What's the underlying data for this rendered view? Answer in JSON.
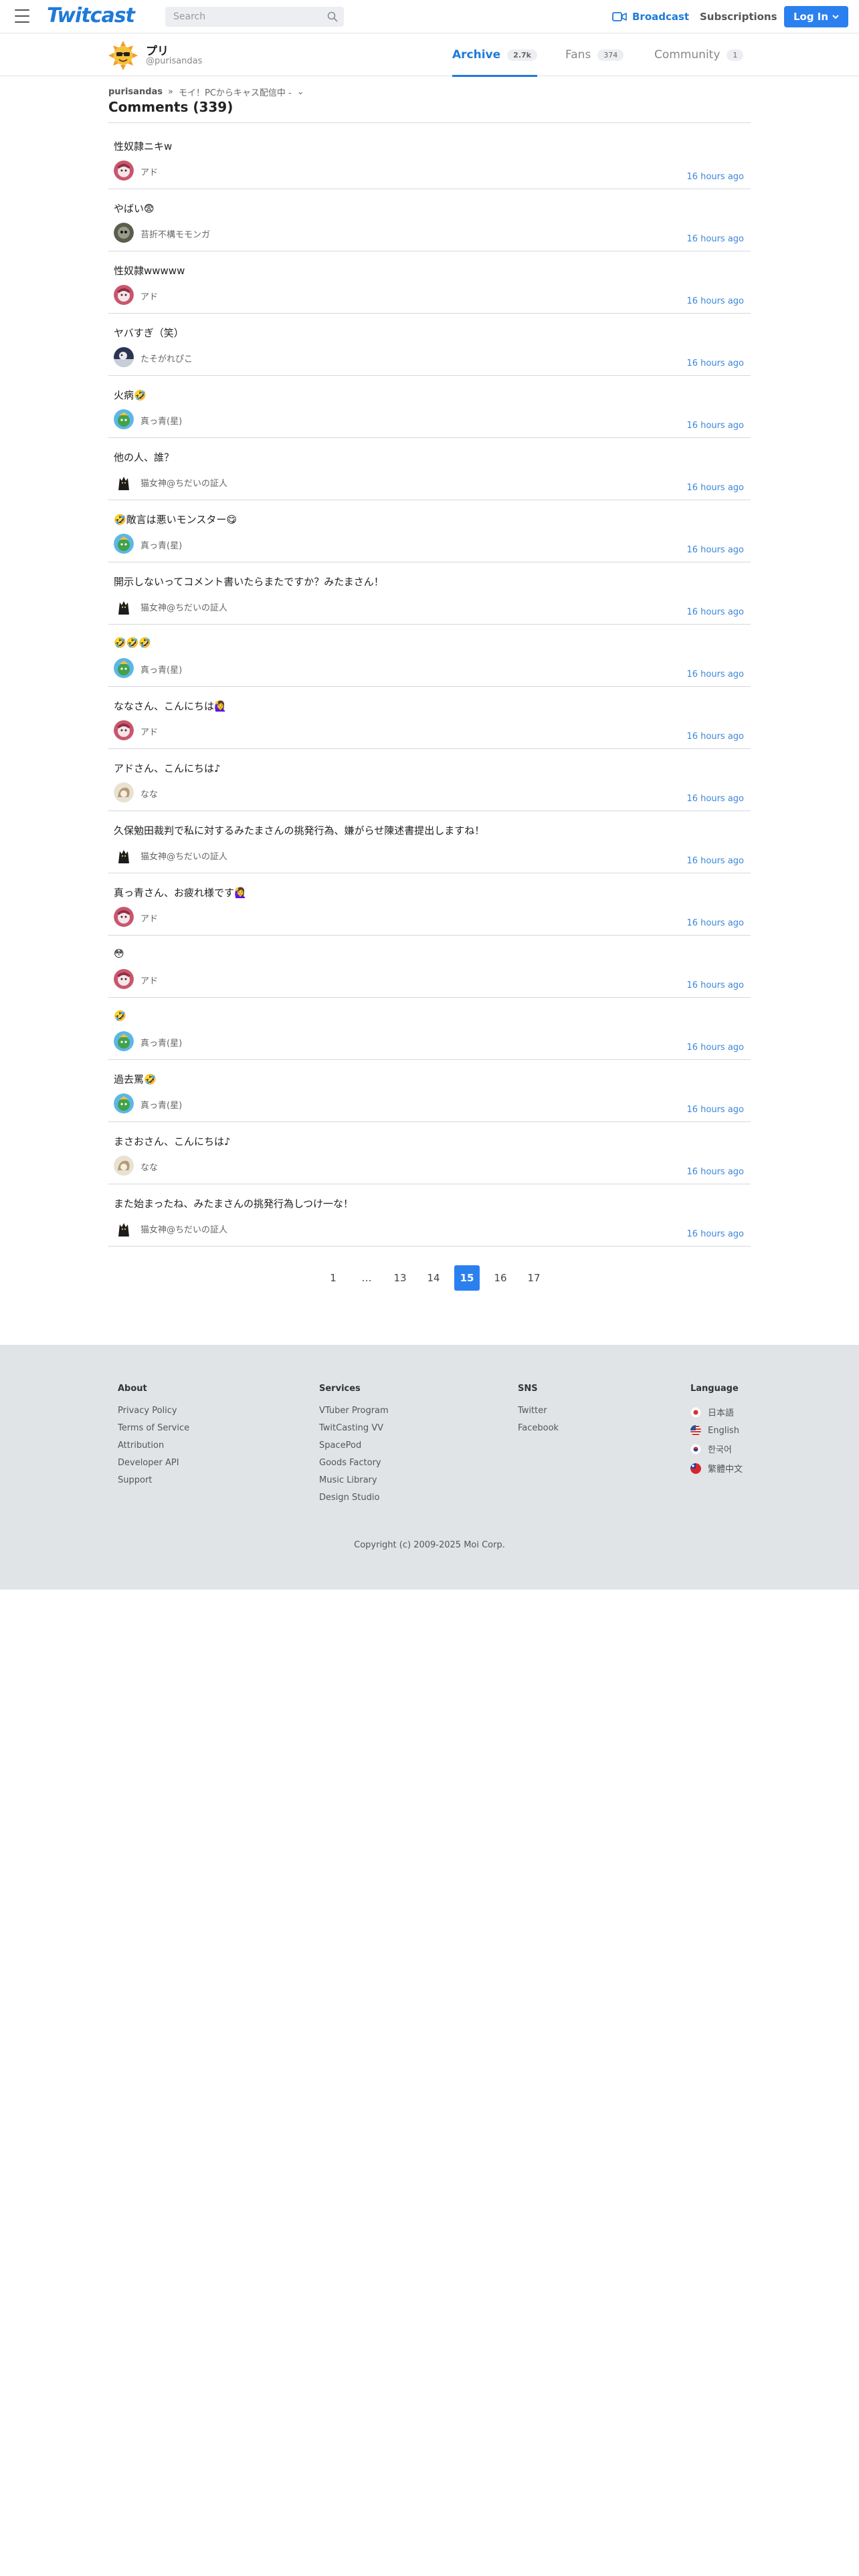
{
  "header": {
    "logo": "Twitcast",
    "search_placeholder": "Search",
    "broadcast_label": "Broadcast",
    "subscriptions_label": "Subscriptions",
    "login_label": "Log In"
  },
  "profile": {
    "name": "プリ",
    "handle": "@purisandas",
    "tabs": [
      {
        "label": "Archive",
        "count": "2.7k"
      },
      {
        "label": "Fans",
        "count": "374"
      },
      {
        "label": "Community",
        "count": "1"
      }
    ]
  },
  "breadcrumb": {
    "user": "purisandas",
    "separator": "»",
    "title": "モイ！PCからキャス配信中 -",
    "chevron": "⌄"
  },
  "comments_heading": "Comments (339)",
  "comments": [
    {
      "text": "性奴隷ニキw",
      "author": "アド",
      "time": "16 hours ago",
      "avatar": "ado"
    },
    {
      "text": "やばい😨",
      "author": "苔折不構モモンガ",
      "time": "16 hours ago",
      "avatar": "momonga"
    },
    {
      "text": "性奴隷wwwww",
      "author": "アド",
      "time": "16 hours ago",
      "avatar": "ado"
    },
    {
      "text": "ヤバすぎ（笑）",
      "author": "たそがれぴこ",
      "time": "16 hours ago",
      "avatar": "tasogare"
    },
    {
      "text": "火病🤣",
      "author": "真っ青(星)",
      "time": "16 hours ago",
      "avatar": "massao"
    },
    {
      "text": "他の人、誰？",
      "author": "猫女神@ちだいの証人",
      "time": "16 hours ago",
      "avatar": "neko"
    },
    {
      "text": "🤣敵言は悪いモンスター😋",
      "author": "真っ青(星)",
      "time": "16 hours ago",
      "avatar": "massao"
    },
    {
      "text": "開示しないってコメント書いたらまたですか？みたまさん！",
      "author": "猫女神@ちだいの証人",
      "time": "16 hours ago",
      "avatar": "neko"
    },
    {
      "text": "🤣🤣🤣",
      "author": "真っ青(星)",
      "time": "16 hours ago",
      "avatar": "massao"
    },
    {
      "text": "ななさん、こんにちは🙋‍♀️",
      "author": "アド",
      "time": "16 hours ago",
      "avatar": "ado"
    },
    {
      "text": "アドさん、こんにちは♪",
      "author": "なな",
      "time": "16 hours ago",
      "avatar": "nana"
    },
    {
      "text": "久保勉田裁判で私に対するみたまさんの挑発行為、嫌がらせ陳述書提出しますね！",
      "author": "猫女神@ちだいの証人",
      "time": "16 hours ago",
      "avatar": "neko"
    },
    {
      "text": "真っ青さん、お疲れ様です🙋‍♀️",
      "author": "アド",
      "time": "16 hours ago",
      "avatar": "ado"
    },
    {
      "text": "😳",
      "author": "アド",
      "time": "16 hours ago",
      "avatar": "ado"
    },
    {
      "text": "🤣",
      "author": "真っ青(星)",
      "time": "16 hours ago",
      "avatar": "massao"
    },
    {
      "text": "過去罵🤣",
      "author": "真っ青(星)",
      "time": "16 hours ago",
      "avatar": "massao"
    },
    {
      "text": "まさおさん、こんにちは♪",
      "author": "なな",
      "time": "16 hours ago",
      "avatar": "nana"
    },
    {
      "text": "また始まったね、みたまさんの挑発行為しつけ一な！",
      "author": "猫女神@ちだいの証人",
      "time": "16 hours ago",
      "avatar": "neko"
    }
  ],
  "pagination": [
    "1",
    "…",
    "13",
    "14",
    "15",
    "16",
    "17"
  ],
  "pagination_current": "15",
  "footer": {
    "about": {
      "title": "About",
      "links": [
        "Privacy Policy",
        "Terms of Service",
        "Attribution",
        "Developer API",
        "Support"
      ]
    },
    "services": {
      "title": "Services",
      "links": [
        "VTuber Program",
        "TwitCasting VV",
        "SpacePod",
        "Goods Factory",
        "Music Library",
        "Design Studio"
      ]
    },
    "sns": {
      "title": "SNS",
      "links": [
        "Twitter",
        "Facebook"
      ]
    },
    "language": {
      "title": "Language",
      "items": [
        {
          "label": "日本語",
          "flag": "jp"
        },
        {
          "label": "English",
          "flag": "us"
        },
        {
          "label": "한국어",
          "flag": "kr"
        },
        {
          "label": "繁體中文",
          "flag": "tw"
        }
      ]
    },
    "copyright": "Copyright (c) 2009-2025 Moi Corp."
  },
  "colors": {
    "brand": "#1f7ad8",
    "button": "#2b80f0",
    "time": "#3d86d9",
    "footer_bg": "#e1e4e7"
  }
}
